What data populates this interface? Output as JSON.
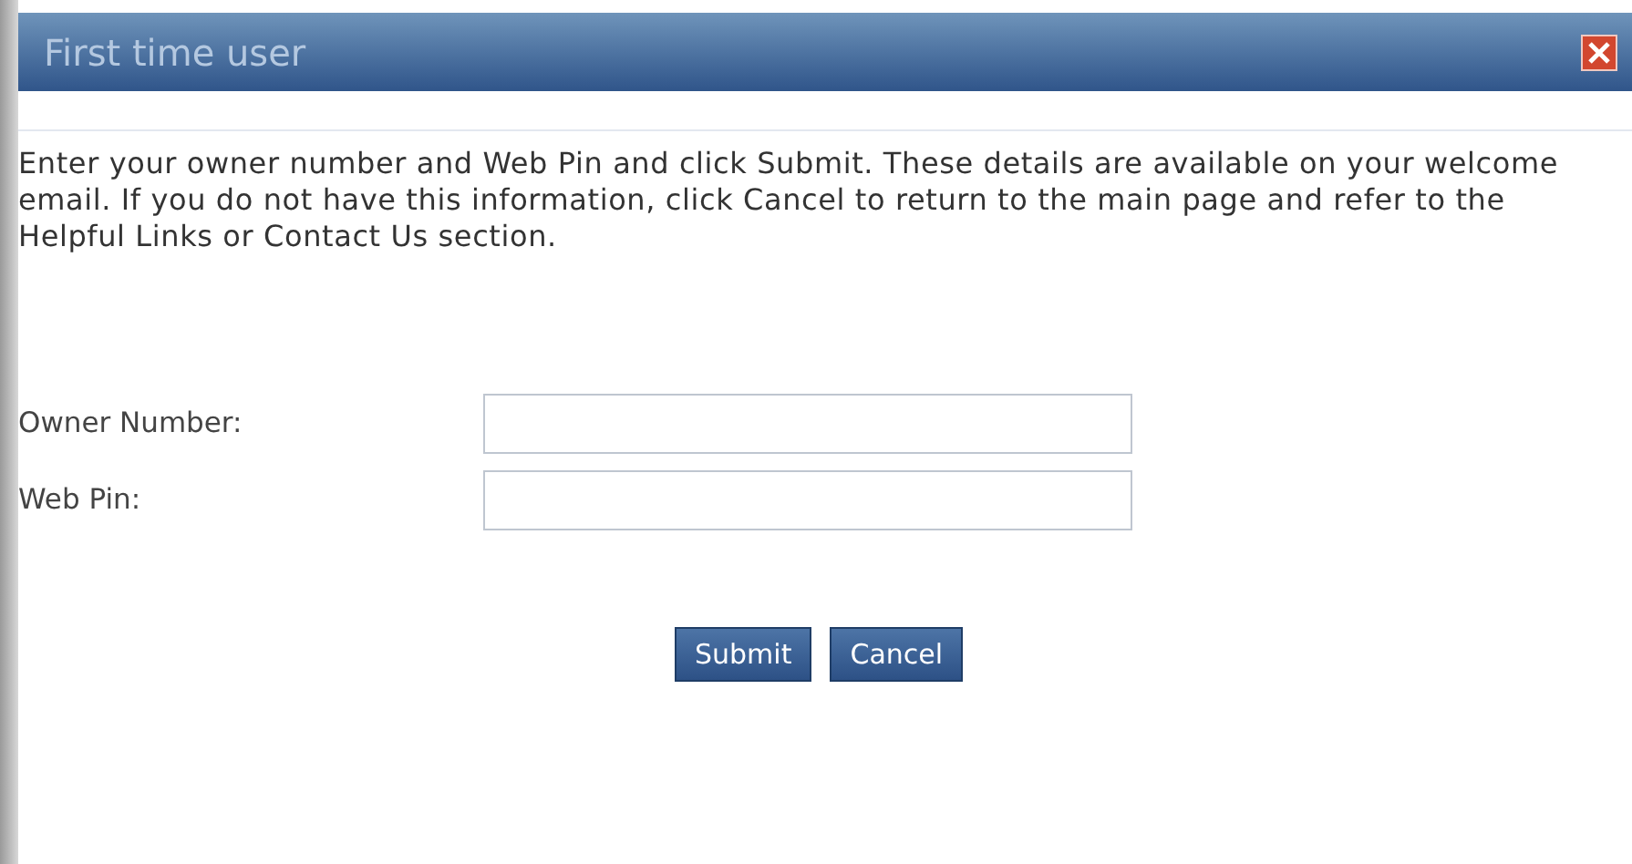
{
  "window": {
    "title": "First time user"
  },
  "instructions": "Enter your owner number and Web Pin and click Submit. These details are available on your welcome email. If you do not have this information, click Cancel to return to the main page and refer to the Helpful Links or Contact Us section.",
  "fields": [
    {
      "label": "Owner Number:"
    },
    {
      "label": "Web Pin:"
    }
  ],
  "buttons": [
    "Submit",
    "Cancel"
  ]
}
